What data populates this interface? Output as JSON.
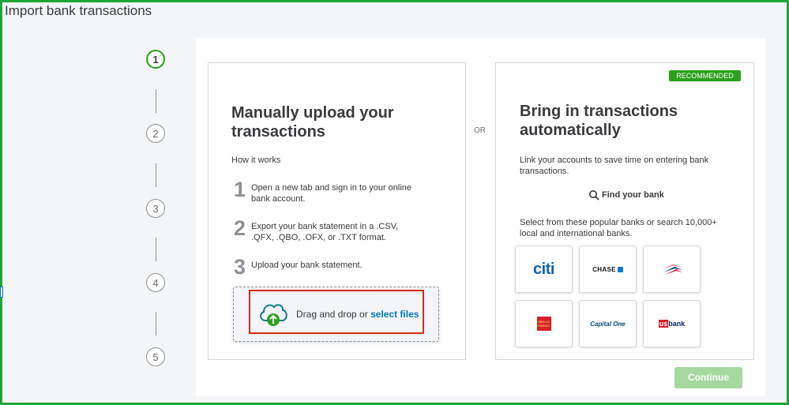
{
  "window": {
    "title": "Import bank transactions"
  },
  "stepper": {
    "steps": [
      "1",
      "2",
      "3",
      "4",
      "5"
    ],
    "active": 1
  },
  "manual": {
    "heading_line1": "Manually upload your",
    "heading_line2": "transactions",
    "how_it_works": "How it works",
    "steps": [
      {
        "num": "1",
        "text": "Open a new tab and sign in to your online bank account."
      },
      {
        "num": "2",
        "text": "Export your bank statement in a .CSV, .QFX, .QBO, .OFX, or .TXT format."
      },
      {
        "num": "3",
        "text": "Upload your bank statement."
      }
    ],
    "drop_text": "Drag and drop or ",
    "drop_link": "select files"
  },
  "or_label": "OR",
  "automatic": {
    "badge": "RECOMMENDED",
    "heading_line1": "Bring in transactions",
    "heading_line2": "automatically",
    "description": "Link your accounts to save time on entering bank transactions.",
    "find_bank": "Find your bank",
    "popular_text": "Select from these popular banks or search 10,000+ local and international banks.",
    "banks": [
      {
        "name": "citi",
        "logo_text": "citi"
      },
      {
        "name": "chase",
        "logo_text": "CHASE"
      },
      {
        "name": "bank-of-america",
        "logo_text": ""
      },
      {
        "name": "wells-fargo",
        "logo_text": "WELLS FARGO"
      },
      {
        "name": "capital-one",
        "logo_text": "Capital One"
      },
      {
        "name": "us-bank",
        "logo_text_us": "us",
        "logo_text_bank": "bank"
      }
    ]
  },
  "continue_label": "Continue",
  "colors": {
    "accent_green": "#2ca01c",
    "link_blue": "#0077c5",
    "highlight_red": "#d52b1e",
    "frame_green": "#1fa534",
    "continue_disabled": "#a5d89e"
  }
}
